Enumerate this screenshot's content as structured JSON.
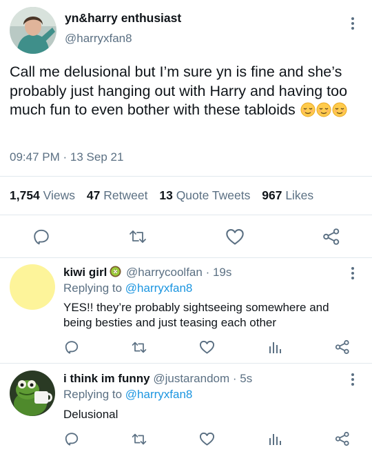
{
  "tweet": {
    "author_name": "yn&harry enthusiast",
    "author_handle": "@harryxfan8",
    "text": "Call me delusional but I’m sure yn is fine and she’s probably just hanging out with Harry and having too much fun to even bother with these tabloids",
    "emoji": [
      "relieved-face",
      "relieved-face",
      "relieved-face"
    ],
    "time": "09:47 PM",
    "separator": "·",
    "date": "13 Sep 21",
    "stats": [
      {
        "count": "1,754",
        "label": "Views"
      },
      {
        "count": "47",
        "label": "Retweet"
      },
      {
        "count": "13",
        "label": "Quote Tweets"
      },
      {
        "count": "967",
        "label": "Likes"
      }
    ],
    "actions": [
      "reply-icon",
      "retweet-icon",
      "like-icon",
      "share-icon"
    ]
  },
  "replies": [
    {
      "name": "kiwi girl",
      "badge_icon": "kiwi-badge-icon",
      "handle": "@harrycoolfan",
      "time": "· 19s",
      "replying_prefix": "Replying to",
      "replying_to": "@harryxfan8",
      "text": "YES!! they’re probably sightseeing somewhere and being besties and just teasing each other",
      "avatar_color": "#fdf49a",
      "actions": [
        "reply-icon",
        "retweet-icon",
        "like-icon",
        "stats-icon",
        "share-icon"
      ]
    },
    {
      "name": "i think im funny",
      "handle": "@justarandom",
      "time": "· 5s",
      "replying_prefix": "Replying to",
      "replying_to": "@harryxfan8",
      "text": "Delusional",
      "actions": [
        "reply-icon",
        "retweet-icon",
        "like-icon",
        "stats-icon",
        "share-icon"
      ]
    }
  ],
  "colors": {
    "text": "#0f1419",
    "muted": "#5b7083",
    "link": "#1b95e0",
    "divider": "#e1e8ed"
  }
}
